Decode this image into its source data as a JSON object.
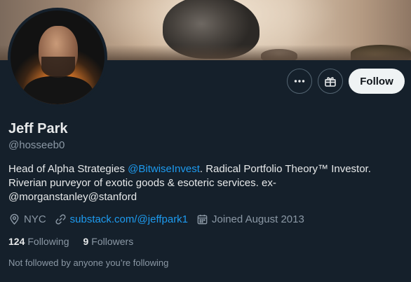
{
  "profile": {
    "name": "Jeff Park",
    "handle": "@hosseeb0",
    "bio": {
      "before_mention": "Head of Alpha Strategies ",
      "mention": "@BitwiseInvest",
      "after_mention": ". Radical Portfolio Theory™ Investor. Riverian purveyor of exotic goods & esoteric services. ex-@morganstanley@stanford"
    },
    "location": "NYC",
    "website": "substack.com/@jeffpark1",
    "joined": "Joined August 2013"
  },
  "actions": {
    "more_icon": "more-horizontal-icon",
    "gift_icon": "gift-icon",
    "follow_label": "Follow"
  },
  "stats": {
    "following_count": "124",
    "following_label": "Following",
    "followers_count": "9",
    "followers_label": "Followers"
  },
  "followed_by_note": "Not followed by anyone you’re following",
  "colors": {
    "background": "#15202b",
    "accent": "#1d9bf0",
    "text": "#e7e9ea",
    "muted": "#8b98a5",
    "follow_button_bg": "#eff3f4"
  },
  "icons": {
    "location": "location-pin-icon",
    "link": "link-icon",
    "calendar": "calendar-icon"
  }
}
